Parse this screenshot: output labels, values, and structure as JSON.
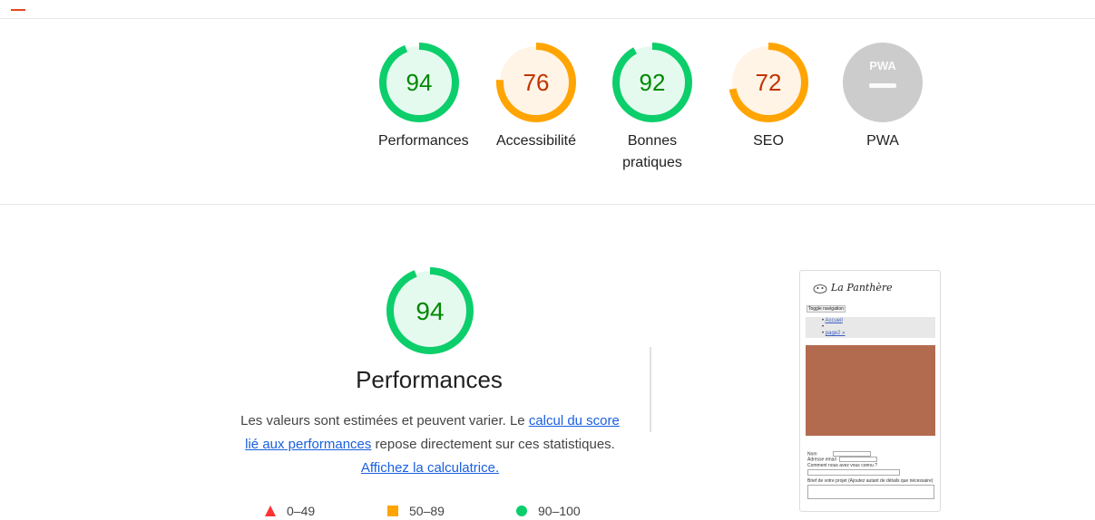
{
  "colors": {
    "pass": "#0cce6b",
    "pass_text": "#008800",
    "pass_bg": "#e5faef",
    "avg": "#ffa400",
    "avg_text": "#c33300",
    "avg_bg": "#fff4e5",
    "na": "#cccccc",
    "fail": "#ff3333"
  },
  "categories": [
    {
      "id": "performances",
      "score": "94",
      "value": 94,
      "label": "Performances",
      "status": "pass"
    },
    {
      "id": "accessibilite",
      "score": "76",
      "value": 76,
      "label": "Accessibilité",
      "status": "average"
    },
    {
      "id": "bonnes-pratiques",
      "score": "92",
      "value": 92,
      "label": "Bonnes pratiques",
      "status": "pass"
    },
    {
      "id": "seo",
      "score": "72",
      "value": 72,
      "label": "SEO",
      "status": "average"
    },
    {
      "id": "pwa",
      "badge": "PWA",
      "label": "PWA",
      "status": "na"
    }
  ],
  "main": {
    "score": "94",
    "value": 94,
    "title": "Performances",
    "desc_prefix": "Les valeurs sont estimées et peuvent varier. Le ",
    "link1": "calcul du score lié aux performances",
    "desc_middle": " repose directement sur ces statistiques. ",
    "link2": "Affichez la calculatrice."
  },
  "legend": [
    {
      "shape": "triangle-icon",
      "range": "0–49"
    },
    {
      "shape": "square-icon",
      "range": "50–89"
    },
    {
      "shape": "circle-icon",
      "range": "90–100"
    }
  ],
  "thumbnail": {
    "brand": "La Panthère",
    "toggle": "Toggle navigation",
    "nav_items": [
      "Accueil",
      "",
      "page2 »"
    ],
    "form_nom": "Nom",
    "form_email": "Adresse email",
    "form_question": "Comment nous avez vous connu ?",
    "form_brief": "Brief de votre projet (Ajoutez autant de détails que nécessaire)"
  }
}
